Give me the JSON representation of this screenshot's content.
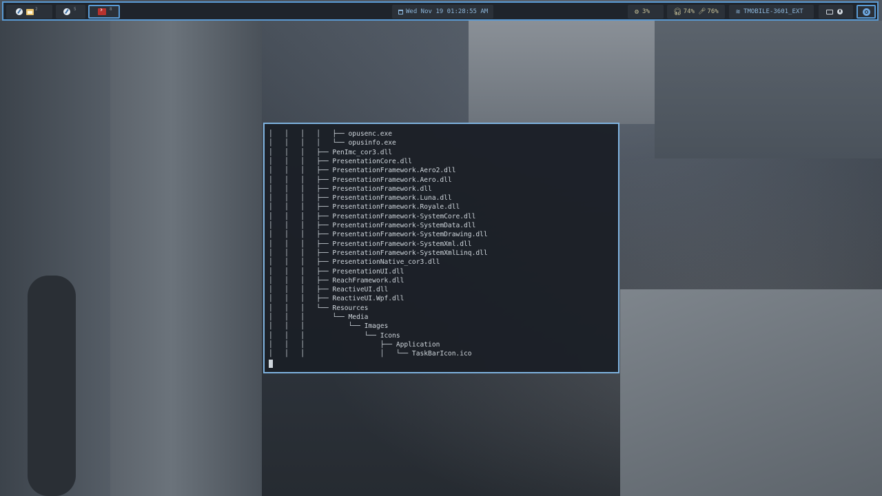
{
  "topbar": {
    "workspaces": [
      {
        "num": "2",
        "apps": [
          "browser-icon",
          "files-icon"
        ]
      },
      {
        "num": "5",
        "apps": [
          "browser-icon"
        ]
      },
      {
        "num": "8",
        "apps": [
          "terminal-icon"
        ],
        "active": true
      }
    ],
    "clock": "Wed Nov 19 01:28:55 AM",
    "cpu": "3%",
    "audio": "74%",
    "mic": "76%",
    "network": "TMOBILE-3601_EXT"
  },
  "terminal": {
    "lines": [
      "│   │   │   │   ├── opusenc.exe",
      "│   │   │   │   └── opusinfo.exe",
      "│   │   │   ├── PenImc_cor3.dll",
      "│   │   │   ├── PresentationCore.dll",
      "│   │   │   ├── PresentationFramework.Aero2.dll",
      "│   │   │   ├── PresentationFramework.Aero.dll",
      "│   │   │   ├── PresentationFramework.dll",
      "│   │   │   ├── PresentationFramework.Luna.dll",
      "│   │   │   ├── PresentationFramework.Royale.dll",
      "│   │   │   ├── PresentationFramework-SystemCore.dll",
      "│   │   │   ├── PresentationFramework-SystemData.dll",
      "│   │   │   ├── PresentationFramework-SystemDrawing.dll",
      "│   │   │   ├── PresentationFramework-SystemXml.dll",
      "│   │   │   ├── PresentationFramework-SystemXmlLinq.dll",
      "│   │   │   ├── PresentationNative_cor3.dll",
      "│   │   │   ├── PresentationUI.dll",
      "│   │   │   ├── ReachFramework.dll",
      "│   │   │   ├── ReactiveUI.dll",
      "│   │   │   ├── ReactiveUI.Wpf.dll",
      "│   │   │   └── Resources",
      "│   │   │       └── Media",
      "│   │   │           └── Images",
      "│   │   │               └── Icons",
      "│   │   │                   ├── Application",
      "│   │   │                   │   └── TaskBarIcon.ico"
    ]
  }
}
